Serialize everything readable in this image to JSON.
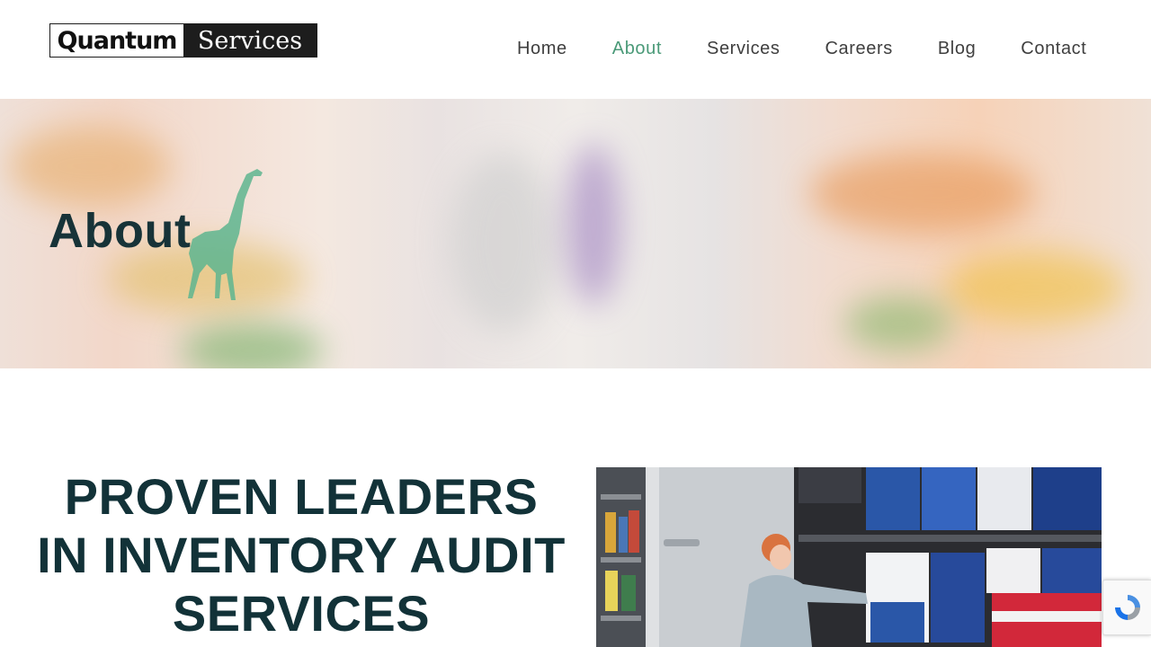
{
  "header": {
    "logo": {
      "left_text": "Quantum",
      "right_text": "Services"
    },
    "nav": [
      {
        "label": "Home",
        "active": false
      },
      {
        "label": "About",
        "active": true
      },
      {
        "label": "Services",
        "active": false
      },
      {
        "label": "Careers",
        "active": false
      },
      {
        "label": "Blog",
        "active": false
      },
      {
        "label": "Contact",
        "active": false
      }
    ]
  },
  "hero": {
    "title": "About"
  },
  "main": {
    "headline": "PROVEN LEADERS IN INVENTORY AUDIT SERVICES"
  },
  "colors": {
    "accent": "#4a9a78",
    "heading": "#123238",
    "logo_dark": "#1d1d1d"
  },
  "icons": {
    "hero_decor": "giraffe-icon",
    "captcha": "recaptcha-icon"
  }
}
